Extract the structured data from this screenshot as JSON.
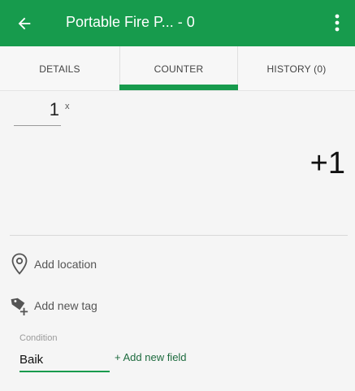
{
  "appbar": {
    "title": "Portable Fire P... - 0",
    "back_icon": "arrow-left-icon",
    "menu_icon": "more-vert-icon",
    "color": "#179b4d"
  },
  "tabs": [
    {
      "label": "DETAILS"
    },
    {
      "label": "COUNTER",
      "active": true
    },
    {
      "label": "HISTORY (0)"
    }
  ],
  "counter": {
    "value": "1",
    "multiplier_suffix": "x",
    "increment_label": "+1"
  },
  "actions": {
    "add_location": "Add location",
    "add_tag": "Add new tag",
    "add_field": "+ Add new field"
  },
  "condition": {
    "label": "Condition",
    "value": "Baik"
  }
}
